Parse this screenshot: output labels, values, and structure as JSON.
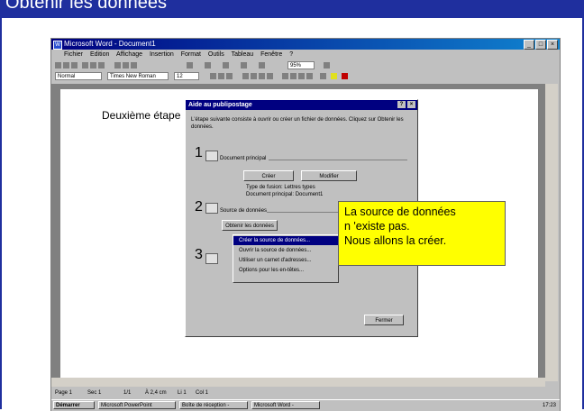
{
  "slide": {
    "title": "Obtenir les données",
    "caption": "Deuxième étape"
  },
  "word": {
    "title": "Microsoft Word - Document1",
    "menu": [
      "Fichier",
      "Edition",
      "Affichage",
      "Insertion",
      "Format",
      "Outils",
      "Tableau",
      "Fenêtre",
      "?"
    ],
    "style_combo": "Normal",
    "font_combo": "Times New Roman",
    "size_combo": "12",
    "zoom_combo": "95%",
    "status": {
      "page": "Page 1",
      "sec": "Sec 1",
      "pages": "1/1",
      "pos": "À 2,4 cm",
      "line": "Li 1",
      "col": "Col 1"
    },
    "taskbar": {
      "start": "Démarrer",
      "t1": "Microsoft PowerPoint",
      "t2": "Boîte de réception -",
      "t3": "Microsoft Word -",
      "clock": "17:23"
    }
  },
  "dialog": {
    "title": "Aide au publipostage",
    "intro": "L'étape suivante consiste à ouvrir ou créer un fichier de données. Cliquez sur Obtenir les données.",
    "step1": {
      "num": "1",
      "label": "Document principal",
      "create": "Créer",
      "edit": "Modifier",
      "info1": "Type de fusion: Lettres types",
      "info2": "Document principal: Document1"
    },
    "step2": {
      "num": "2",
      "label": "Source de données",
      "get": "Obtenir les données"
    },
    "step3": {
      "num": "3"
    },
    "menu": [
      "Créer la source de données...",
      "Ouvrir la source de données...",
      "Utiliser un carnet d'adresses...",
      "Options pour les en-têtes..."
    ],
    "close": "Fermer"
  },
  "callout": {
    "line1": "La source de données",
    "line2": "n 'existe pas.",
    "line3": "Nous allons la créer."
  },
  "colors": {
    "accent": "#1f2f9e",
    "callout": "#ffff00",
    "selection": "#000080"
  }
}
